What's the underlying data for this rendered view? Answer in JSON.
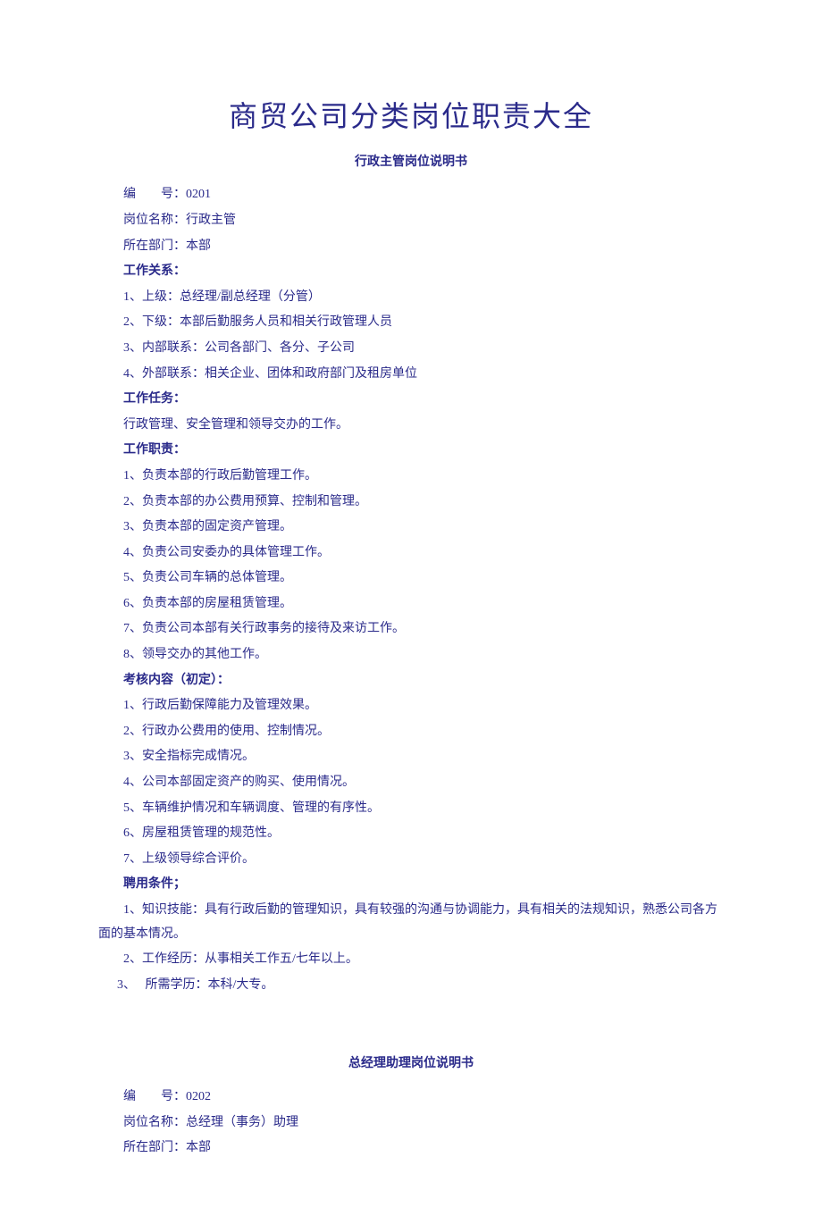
{
  "main_title": "商贸公司分类岗位职责大全",
  "job1": {
    "sub_title": "行政主管岗位说明书",
    "code_label": "编　　号：",
    "code_value": "0201",
    "name_label": "岗位名称：",
    "name_value": "行政主管",
    "dept_label": "所在部门：",
    "dept_value": "本部",
    "rel_heading": "工作关系：",
    "rel_items": [
      "1、上级：总经理/副总经理（分管）",
      "2、下级：本部后勤服务人员和相关行政管理人员",
      "3、内部联系：公司各部门、各分、子公司",
      "4、外部联系：相关企业、团体和政府部门及租房单位"
    ],
    "task_heading": "工作任务：",
    "task_text": "行政管理、安全管理和领导交办的工作。",
    "duty_heading": "工作职责：",
    "duty_items": [
      "1、负责本部的行政后勤管理工作。",
      "2、负责本部的办公费用预算、控制和管理。",
      "3、负责本部的固定资产管理。",
      "4、负责公司安委办的具体管理工作。",
      "5、负责公司车辆的总体管理。",
      "6、负责本部的房屋租赁管理。",
      "7、负责公司本部有关行政事务的接待及来访工作。",
      "8、领导交办的其他工作。"
    ],
    "assess_heading": "考核内容（初定）：",
    "assess_items": [
      "1、行政后勤保障能力及管理效果。",
      "2、行政办公费用的使用、控制情况。",
      "3、安全指标完成情况。",
      "4、公司本部固定资产的购买、使用情况。",
      "5、车辆维护情况和车辆调度、管理的有序性。",
      "6、房屋租赁管理的规范性。",
      "7、上级领导综合评价。"
    ],
    "employ_heading": "聘用条件；",
    "employ_items": [
      "1、知识技能：具有行政后勤的管理知识，具有较强的沟通与协调能力，具有相关的法规知识，熟悉公司各方面的基本情况。",
      "2、工作经历：从事相关工作五/七年以上。"
    ],
    "employ_item3_num": "3、",
    "employ_item3_text": "所需学历：本科/大专。"
  },
  "job2": {
    "sub_title": "总经理助理岗位说明书",
    "code_label": "编　　号：",
    "code_value": "0202",
    "name_label": "岗位名称：",
    "name_value": "总经理（事务）助理",
    "dept_label": "所在部门：",
    "dept_value": "本部"
  }
}
